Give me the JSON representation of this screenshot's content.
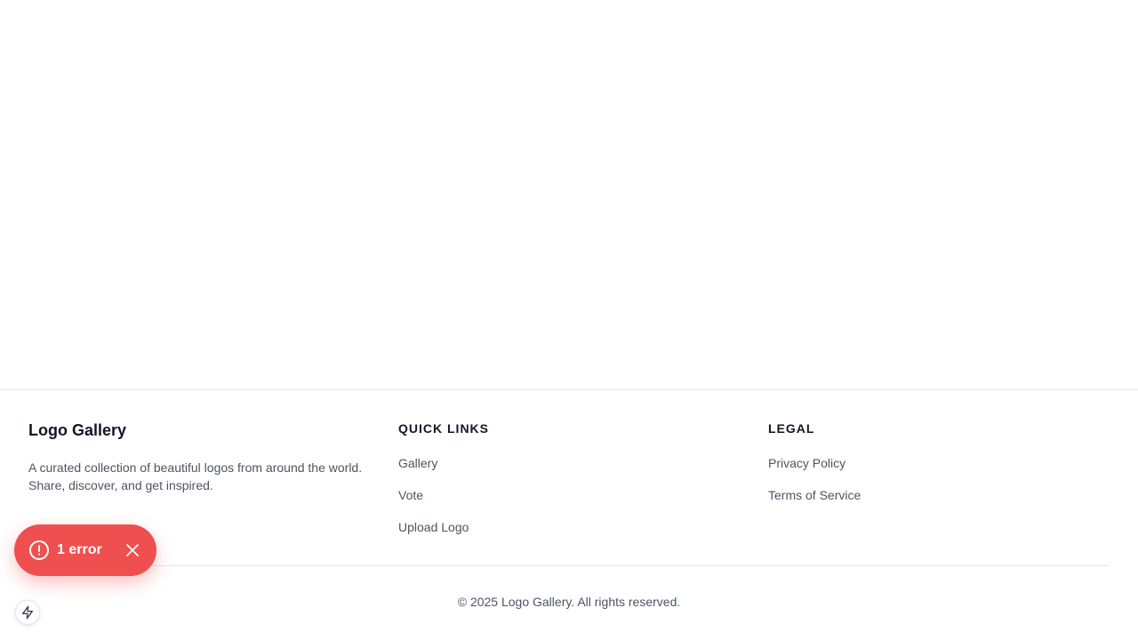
{
  "footer": {
    "brand": {
      "title": "Logo Gallery",
      "description": "A curated collection of beautiful logos from around the world. Share, discover, and get inspired."
    },
    "quick_links": {
      "heading": "QUICK LINKS",
      "items": [
        {
          "label": "Gallery"
        },
        {
          "label": "Vote"
        },
        {
          "label": "Upload Logo"
        }
      ]
    },
    "legal": {
      "heading": "LEGAL",
      "items": [
        {
          "label": "Privacy Policy"
        },
        {
          "label": "Terms of Service"
        }
      ]
    },
    "copyright": "© 2025 Logo Gallery. All rights reserved."
  },
  "error_indicator": {
    "label": "1 error",
    "icon": "alert-circle-icon",
    "close_icon": "close-icon",
    "color": "#f04f4f"
  },
  "dev_tool_badge": {
    "icon": "lightning-bolt-icon"
  }
}
